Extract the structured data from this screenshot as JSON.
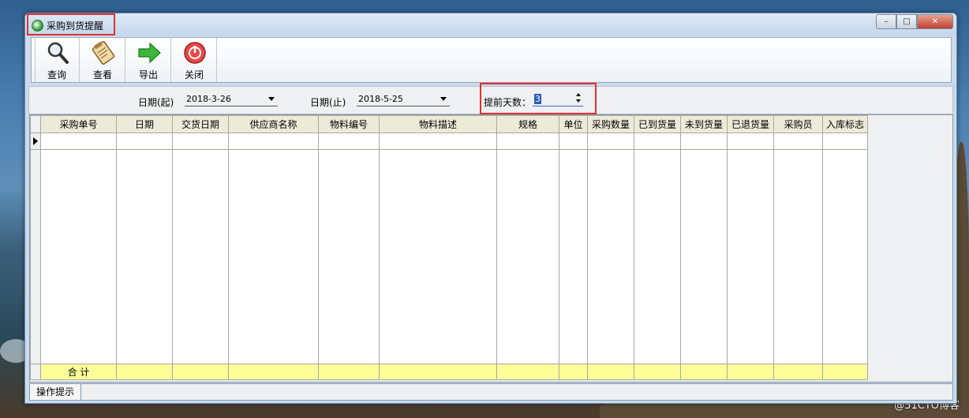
{
  "window": {
    "title": "采购到货提醒",
    "controls": {
      "minimize": "–",
      "maximize": "□",
      "close": "✕"
    }
  },
  "toolbar": {
    "buttons": [
      {
        "label": "查询",
        "icon": "magnifier-icon"
      },
      {
        "label": "查看",
        "icon": "clipboard-icon"
      },
      {
        "label": "导出",
        "icon": "green-arrow-icon"
      },
      {
        "label": "关闭",
        "icon": "power-off-icon"
      }
    ]
  },
  "filters": {
    "date_from_label": "日期(起)",
    "date_from_value": "2018-3-26",
    "date_to_label": "日期(止)",
    "date_to_value": "2018-5-25",
    "advance_days_label": "提前天数：",
    "advance_days_value": "3"
  },
  "grid": {
    "columns": [
      "采购单号",
      "日期",
      "交货日期",
      "供应商名称",
      "物料编号",
      "物料描述",
      "规格",
      "单位",
      "采购数量",
      "已到货量",
      "未到货量",
      "已退货量",
      "采购员",
      "入库标志"
    ],
    "totals_label": "合 计"
  },
  "status": {
    "tab_label": "操作提示"
  },
  "desktop": {
    "watermark": "@51CTO博客"
  },
  "colors": {
    "highlight_box": "#e03030",
    "totals_row": "#ffff99",
    "header_bg": "#ecebd9"
  }
}
